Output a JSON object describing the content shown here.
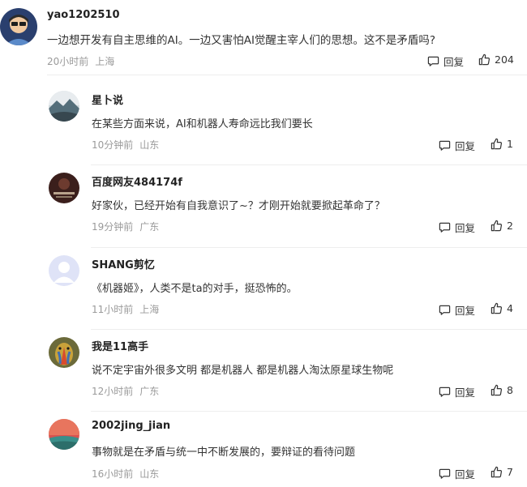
{
  "reply_label": "回复",
  "top_comment": {
    "username": "yao1202510",
    "content": "一边想开发有自主思维的AI。一边又害怕AI觉醒主宰人们的思想。这不是矛盾吗?",
    "time": "20小时前",
    "location": "上海",
    "likes": "204",
    "avatar_icon": "cartoon-avatar"
  },
  "replies": [
    {
      "username": "星卜说",
      "content": "在某些方面来说，AI和机器人寿命远比我们要长",
      "time": "10分钟前",
      "location": "山东",
      "likes": "1",
      "avatar_icon": "landscape-avatar"
    },
    {
      "username": "百度网友484174f",
      "content": "好家伙，已经开始有自我意识了~？才刚开始就要掀起革命了？",
      "time": "19分钟前",
      "location": "广东",
      "likes": "2",
      "avatar_icon": "dark-text-avatar"
    },
    {
      "username": "SHANG剪忆",
      "content": "《机器姬》，人类不是ta的对手，挺恐怖的。",
      "time": "11小时前",
      "location": "上海",
      "likes": "4",
      "avatar_icon": "default-user-avatar"
    },
    {
      "username": "我是11高手",
      "content": "说不定宇宙外很多文明 都是机器人 都是机器人淘汰原星球生物呢",
      "time": "12小时前",
      "location": "广东",
      "likes": "8",
      "avatar_icon": "mandrill-avatar"
    },
    {
      "username": "2002jing_jian",
      "content": "事物就是在矛盾与统一中不断发展的，要辩证的看待问题",
      "time": "16小时前",
      "location": "山东",
      "likes": "7",
      "avatar_icon": "sunset-avatar"
    }
  ]
}
